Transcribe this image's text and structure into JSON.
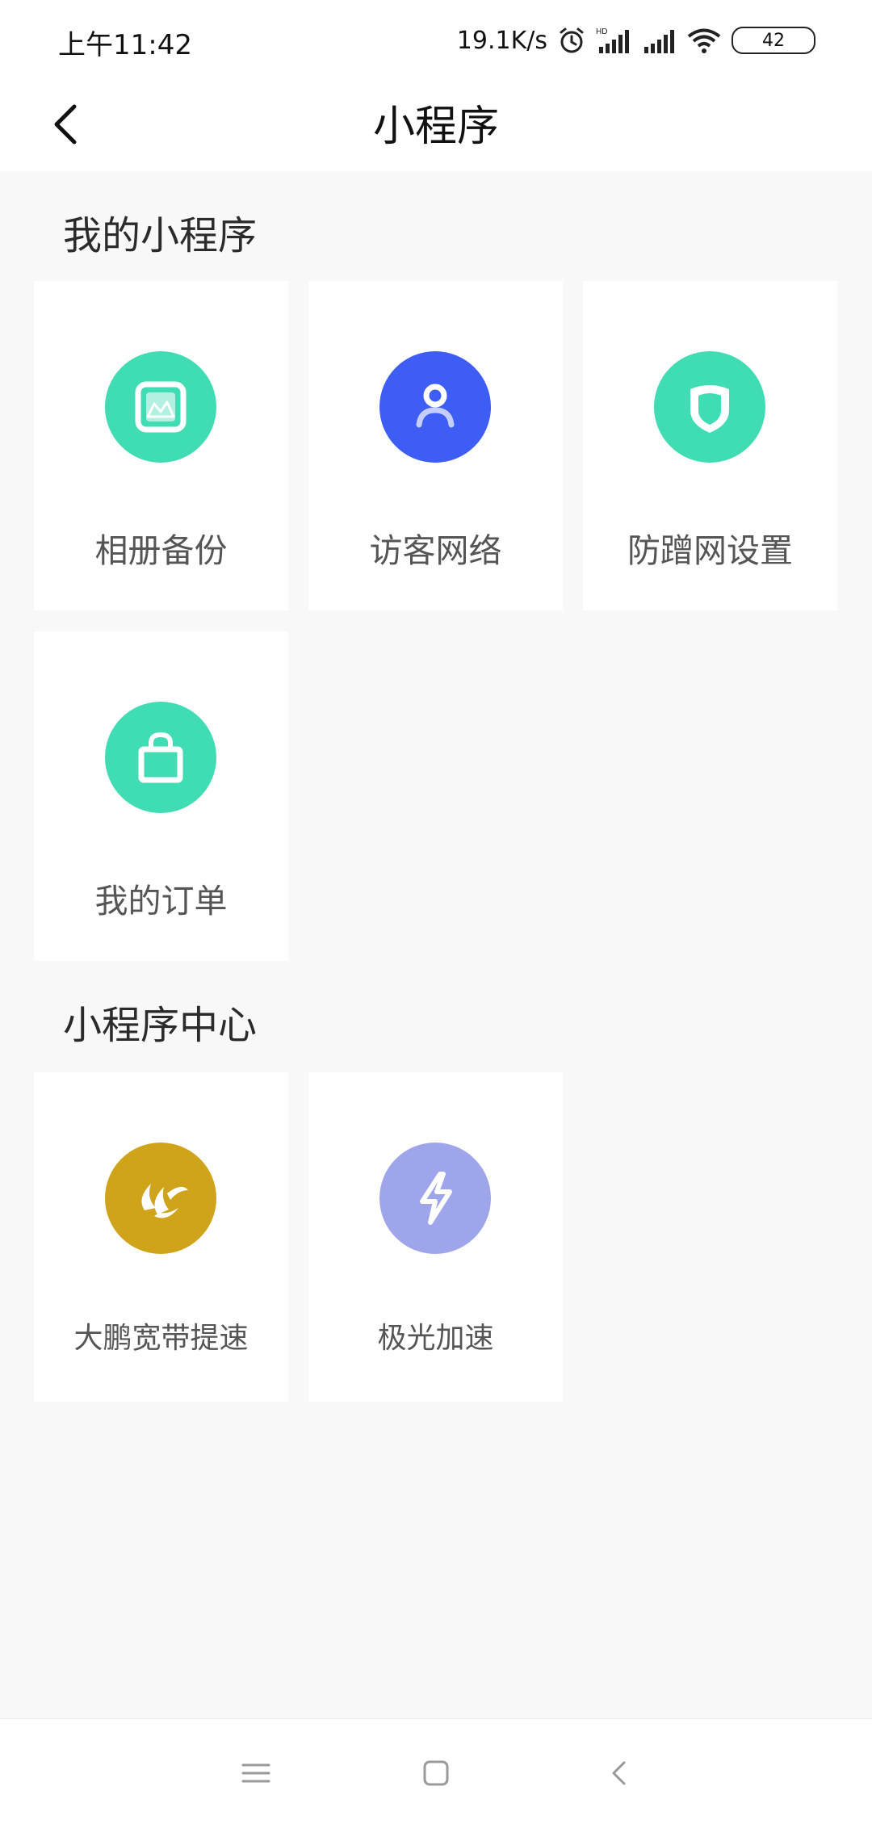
{
  "status_bar": {
    "time": "上午11:42",
    "network_speed": "19.1K/s",
    "battery": "42",
    "icons": [
      "alarm-icon",
      "hd-signal-icon",
      "signal-icon",
      "wifi-icon",
      "battery-icon"
    ]
  },
  "header": {
    "title": "小程序",
    "back_icon": "back-arrow-icon"
  },
  "my_mini_programs": {
    "title": "我的小程序",
    "items": [
      {
        "label": "相册备份",
        "icon": "photo-album-icon",
        "color": "#40dcb3"
      },
      {
        "label": "访客网络",
        "icon": "guest-user-icon",
        "color": "#3e5df5"
      },
      {
        "label": "防蹭网设置",
        "icon": "shield-icon",
        "color": "#40dcb3"
      },
      {
        "label": "我的订单",
        "icon": "shopping-bag-icon",
        "color": "#40dcb3"
      }
    ]
  },
  "mini_program_center": {
    "title": "小程序中心",
    "items": [
      {
        "label": "大鹏宽带提速",
        "icon": "dapeng-logo-icon",
        "color": "#d0a41a"
      },
      {
        "label": "极光加速",
        "icon": "lightning-icon",
        "color": "#9fa5ea"
      }
    ]
  },
  "nav_bar": {
    "icons": [
      "menu-icon",
      "home-icon",
      "back-icon"
    ]
  }
}
